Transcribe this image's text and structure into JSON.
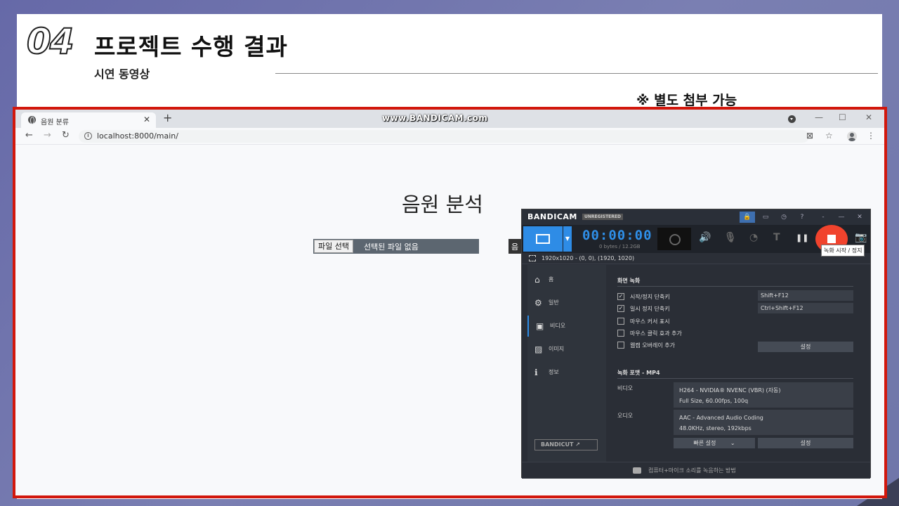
{
  "slide": {
    "number": "04",
    "title": "프로젝트 수행 결과",
    "subtitle": "시연 동영상",
    "note": "※ 별도 첨부 가능"
  },
  "browser": {
    "tab_title": "음원 분류",
    "tab_close": "✕",
    "new_tab": "+",
    "watermark": "www.BANDICAM.com",
    "window_controls": [
      "—",
      "☐",
      "✕"
    ],
    "url": "localhost:8000/main/",
    "nav": {
      "back": "←",
      "forward": "→",
      "reload": "↻"
    },
    "right_icons": {
      "translate": "⊠",
      "star": "☆",
      "menu": "⋮"
    }
  },
  "page": {
    "heading": "음원 분석",
    "file_button": "파일 선택",
    "file_status": "선택된 파일 없음",
    "hidden_button": "음"
  },
  "bandicam": {
    "logo": "BANDICAM",
    "unregistered": "UNREGISTERED",
    "top_icons": [
      "🔒",
      "▭",
      "◷",
      "?",
      "-",
      "—",
      "✕"
    ],
    "timer": "00:00:00",
    "size": "0 bytes / 12.2GB",
    "tools": {
      "speaker": "🔊",
      "mic": "🎙",
      "mouse": "◔",
      "text": "T",
      "pause": "❚❚",
      "camera": "📷"
    },
    "tooltip": "녹화 시작 / 정지",
    "region": "1920x1020 - (0, 0), (1920, 1020)",
    "nav": [
      {
        "icon": "⌂",
        "label": "홈"
      },
      {
        "icon": "⚙",
        "label": "일반"
      },
      {
        "icon": "▣",
        "label": "비디오"
      },
      {
        "icon": "▨",
        "label": "이미지"
      },
      {
        "icon": "ℹ",
        "label": "정보"
      }
    ],
    "bandicut": "BANDICUT ↗",
    "section_record": "화면 녹화",
    "checks": [
      {
        "label": "시작/정지 단축키",
        "checked": true,
        "mark": "✓"
      },
      {
        "label": "일시 정지 단축키",
        "checked": true,
        "mark": "✓"
      },
      {
        "label": "마우스 커서 표시",
        "checked": false,
        "mark": ""
      },
      {
        "label": "마우스 클릭 효과 추가",
        "checked": false,
        "mark": ""
      },
      {
        "label": "웹캠 오버레이 추가",
        "checked": false,
        "mark": ""
      }
    ],
    "hotkey1": "Shift+F12",
    "hotkey2": "Ctrl+Shift+F12",
    "settings_btn": "설정",
    "section_format": "녹화 포맷 - MP4",
    "video_label": "비디오",
    "video_line1": "H264 - NVIDIA® NVENC (VBR) (자동)",
    "video_line2": "Full Size, 60.00fps, 100q",
    "audio_label": "오디오",
    "audio_line1": "AAC - Advanced Audio Coding",
    "audio_line2": "48.0KHz, stereo, 192kbps",
    "quick_settings": "빠른 설정",
    "quick_caret": "⌄",
    "settings_btn2": "설정",
    "footer": "컴퓨터+마이크 소리를 녹음하는 방법"
  }
}
